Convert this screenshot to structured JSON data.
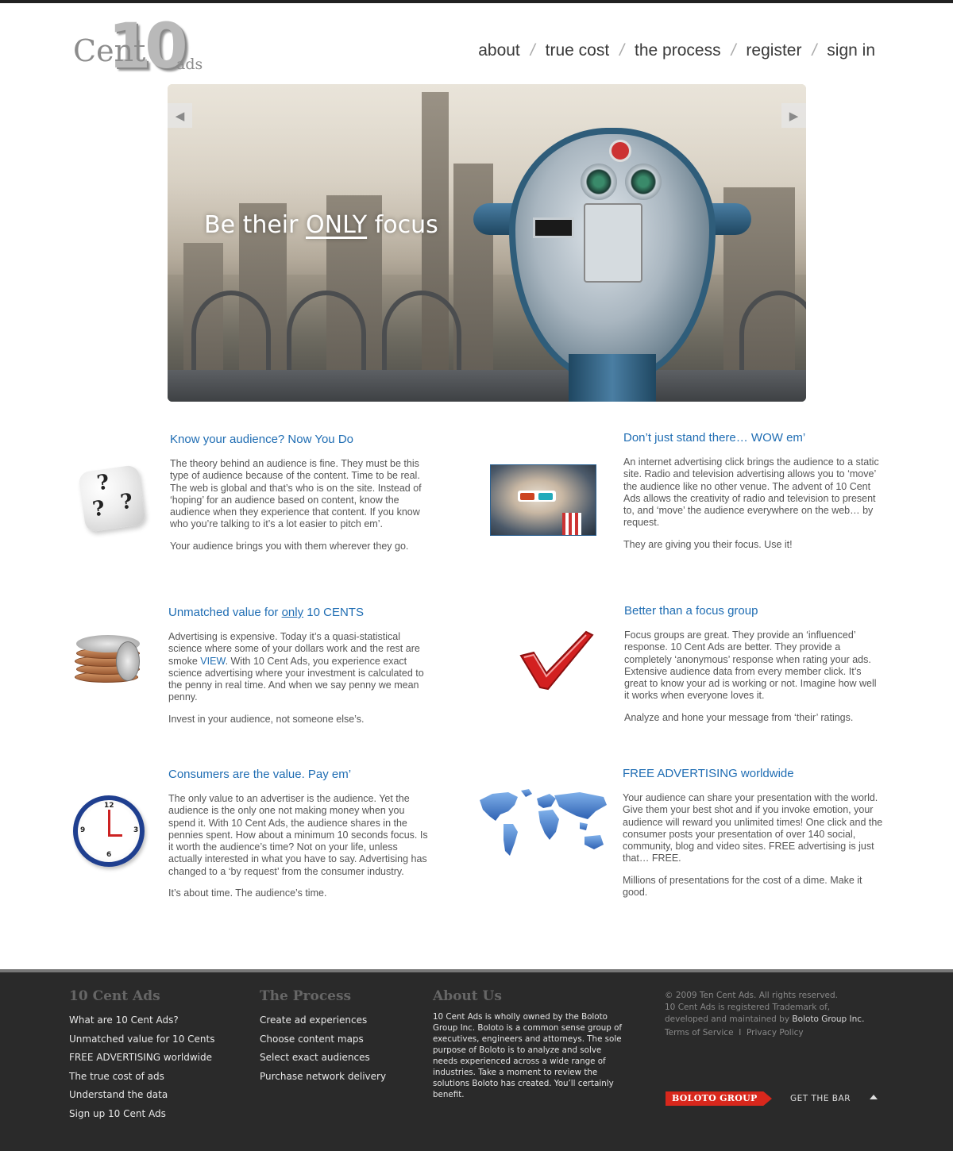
{
  "logo": {
    "number": "10",
    "word": "Cent",
    "suffix": "ads"
  },
  "nav": {
    "items": [
      "about",
      "true cost",
      "the process",
      "register",
      "sign in"
    ],
    "separator": "/"
  },
  "hero": {
    "tagline_pre": "Be their ",
    "tagline_emph": "ONLY",
    "tagline_post": " focus",
    "prev_icon": "arrow-left-icon",
    "next_icon": "arrow-right-icon"
  },
  "sections": {
    "audience": {
      "title": "Know your audience?  Now You Do",
      "p1": "The theory behind an audience is fine. They must be this type of audience because of the content. Time to be real. The web is global and that’s who is on the site. Instead of ‘hoping’ for an audience based on content, know the audience when they experience that content. If you know who you’re talking to it’s a lot easier to pitch em’.",
      "p2": "Your audience brings you with them wherever they go."
    },
    "wow": {
      "title": "Don’t just stand there… WOW em’",
      "p1": "An internet advertising click brings the audience to a static site. Radio and television advertising allows you to ‘move’ the audience like no other venue. The advent of 10 Cent Ads allows the creativity of radio and television to present to, and ‘move’ the audience everywhere on the web… by request.",
      "p2": "They are giving you their focus. Use it!"
    },
    "value": {
      "title_pre": "Unmatched value for ",
      "title_emph": "only",
      "title_post": " 10 CENTS",
      "p1_a": "Advertising is expensive. Today it’s a quasi-statistical science where some of your dollars work and the rest are smoke ",
      "p1_link": "VIEW",
      "p1_b": ". With 10 Cent Ads, you experience exact science advertising where your investment is calculated to the penny in real time. And when we say penny we mean penny.",
      "p2": "Invest in your audience, not someone else’s."
    },
    "focus": {
      "title": "Better than a focus group",
      "p1": "Focus groups are great. They provide an ‘influenced’ response. 10 Cent Ads are better. They provide a completely ‘anonymous’ response when rating your ads. Extensive audience data from every member click. It’s great to know your ad is working or not. Imagine how well it works when everyone loves it.",
      "p2": "Analyze and hone your message from ‘their’ ratings."
    },
    "consumers": {
      "title": "Consumers are the value.  Pay em’",
      "p1": "The only value to an advertiser is the audience. Yet the audience is the only one not making money when you spend it. With 10 Cent Ads, the audience shares in the pennies spent. How about a minimum 10 seconds focus. Is it worth the audience’s time? Not on your life, unless actually interested in what you have to say. Advertising has changed to a ‘by request’ from the consumer industry.",
      "p2": "It’s about time. The audience’s time."
    },
    "free": {
      "title": "FREE ADVERTISING worldwide",
      "p1": "Your audience can share your presentation with the world. Give them your best shot and if you invoke emotion, your audience will reward you unlimited times! One click and the consumer posts your presentation of over 140 social, community, blog and video sites. FREE advertising is just that… FREE.",
      "p2": "Millions of presentations for the cost of a dime. Make it good."
    }
  },
  "images": {
    "dice": {
      "icon": "question-dice-icon",
      "marks": [
        "?",
        "?",
        "?"
      ]
    },
    "photo": {
      "icon": "3d-glasses-photo"
    },
    "coins": {
      "icon": "coin-stack-icon"
    },
    "check": {
      "icon": "checkmark-icon",
      "color": "#d32020"
    },
    "clock": {
      "icon": "clock-icon",
      "numbers": [
        "12",
        "3",
        "6",
        "9"
      ]
    },
    "map": {
      "icon": "world-map-icon",
      "color": "#4a86d0"
    }
  },
  "footer": {
    "col1": {
      "title": "10 Cent Ads",
      "items": [
        "What are 10 Cent Ads?",
        "Unmatched value for 10 Cents",
        "FREE ADVERTISING worldwide",
        "The true cost of ads",
        "Understand the data",
        "Sign up 10 Cent Ads"
      ]
    },
    "col2": {
      "title": "The Process",
      "items": [
        "Create ad experiences",
        "Choose content maps",
        "Select exact audiences",
        "Purchase network delivery"
      ]
    },
    "col3": {
      "title": "About Us",
      "text": "10 Cent Ads is wholly owned by the Boloto Group Inc.  Boloto is a common sense group of executives, engineers and attorneys. The sole purpose of Boloto is to analyze and solve needs experienced across a wide range of industries. Take a moment to review the solutions Boloto has created. You’ll certainly benefit."
    },
    "legal": {
      "copyright": "© 2009 Ten Cent Ads. All rights reserved.",
      "trademark": "10 Cent Ads is registered Trademark of,",
      "developed": "developed and maintained by ",
      "company": "Boloto Group Inc.",
      "terms": "Terms of Service",
      "divider": "I",
      "privacy": "Privacy Policy"
    },
    "boloto_badge": "BOLOTO GROUP",
    "get_bar": "GET THE BAR",
    "caret_icon": "caret-up-icon"
  },
  "colors": {
    "accent": "#1f6db3",
    "footer_bg": "#2a2a2a",
    "badge": "#d8271c"
  }
}
